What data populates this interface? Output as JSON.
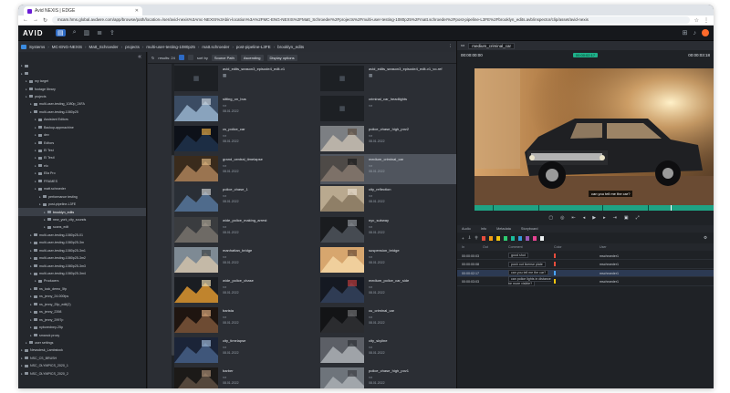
{
  "browser": {
    "tab_title": "Avid NEXIS | EDGE",
    "url": "mcam.hms.global.avdwre.com/app/browse/path/location=/ser/avid-nexis%3Amc-NEXIS%3Abin-location%3A%2FMC-ENG-NEXIS%2FMatt_Schroeder%2Fprojects%2Fmulti-user-testing-1080p25%2Fmatt.schroeder%2Fpost-pipeline-L3FE%2Fbrooklyn_edits.avb/inspector/clip/asset/avid-nexis"
  },
  "app": {
    "logo": "AVID",
    "icons": {
      "apps": "grid-icon",
      "bell": "bell-icon",
      "user": "user-icon"
    }
  },
  "breadcrumb": [
    "Systems",
    "MC-ENG-NEXIS",
    "Matt_Schroeder",
    "projects",
    "multi-user-testing-1080p25",
    "matt.schroeder",
    "post-pipeline-L3FE",
    "brooklyn_edits"
  ],
  "tree": [
    {
      "label": "",
      "depth": 0
    },
    {
      "label": "",
      "depth": 0
    },
    {
      "label": "my target",
      "depth": 1
    },
    {
      "label": "footage library",
      "depth": 1
    },
    {
      "label": "projects",
      "depth": 1
    },
    {
      "label": "multi-user-testing_1080p_24FA",
      "depth": 2
    },
    {
      "label": "multi-user-testing-1080p25",
      "depth": 2
    },
    {
      "label": "Assistant Editors",
      "depth": 3
    },
    {
      "label": "Backup-appmachine",
      "depth": 3
    },
    {
      "label": "dev",
      "depth": 3
    },
    {
      "label": "Editors",
      "depth": 3
    },
    {
      "label": "El Test",
      "depth": 3
    },
    {
      "label": "El Testl",
      "depth": 3
    },
    {
      "label": "elo",
      "depth": 3
    },
    {
      "label": "Ella Pro",
      "depth": 3
    },
    {
      "label": "FRAMES",
      "depth": 3
    },
    {
      "label": "matt.schroeder",
      "depth": 3
    },
    {
      "label": "performance testing",
      "depth": 4
    },
    {
      "label": "post-pipeline-L3FE",
      "depth": 4
    },
    {
      "label": "brooklyn_edits",
      "depth": 5,
      "selected": true
    },
    {
      "label": "new_york_city_sounds",
      "depth": 5
    },
    {
      "label": "scans_edit",
      "depth": 5
    },
    {
      "label": "multi-user-testing-1080p25-01",
      "depth": 2
    },
    {
      "label": "multi-user-testing-1080p25-3m",
      "depth": 2
    },
    {
      "label": "multi-user-testing-1080p25-3m1",
      "depth": 2
    },
    {
      "label": "multi-user-testing-1080p25-3m2",
      "depth": 2
    },
    {
      "label": "multi-user-testing-1080p25-3m3",
      "depth": 2
    },
    {
      "label": "multi-user-testing-1080p25-3m4",
      "depth": 2
    },
    {
      "label": "Producers",
      "depth": 3
    },
    {
      "label": "ns_lock_demo_5fp",
      "depth": 2
    },
    {
      "label": "ns_jenny_24.000fps",
      "depth": 2
    },
    {
      "label": "ns_jenny_25p_edit(2)",
      "depth": 2
    },
    {
      "label": "ns_jenny_2398",
      "depth": 2
    },
    {
      "label": "ns_jenny_2997p",
      "depth": 2
    },
    {
      "label": "nyboredney-25p",
      "depth": 2
    },
    {
      "label": "smanck proxy",
      "depth": 2
    },
    {
      "label": "user settings",
      "depth": 1
    },
    {
      "label": "Newsdesk_Lambstock",
      "depth": 0
    },
    {
      "label": "NSC_CS_BRUSH",
      "depth": 0
    },
    {
      "label": "NSC_OLYMPICS_2020_1",
      "depth": 0
    },
    {
      "label": "NSC_OLYMPICS_2020_2",
      "depth": 0
    }
  ],
  "toolbar": {
    "results": "results: 24",
    "sort_label": "sort by",
    "sort_value": "Source Path",
    "order": "Ascending",
    "display": "Display options"
  },
  "clips": [
    {
      "name": "avid_edits_season3_episode4_edit-v1",
      "type": "sequence",
      "date": "",
      "thumb": "empty"
    },
    {
      "name": "avid_edits_season3_episode4_edit-v1_vo-ref",
      "type": "sequence",
      "date": "",
      "thumb": "empty"
    },
    {
      "name": "sitting_on_bus",
      "type": "clip",
      "date": "08.01.2022",
      "thumb": "bus"
    },
    {
      "name": "criminal_car_headlights",
      "type": "clip",
      "date": "",
      "thumb": "empty"
    },
    {
      "name": "cs_police_car",
      "type": "clip",
      "date": "08.01.2022",
      "thumb": "night"
    },
    {
      "name": "police_chase_high_pov2",
      "type": "clip",
      "date": "08.01.2022",
      "thumb": "city"
    },
    {
      "name": "grand_central_timelapse",
      "type": "clip",
      "date": "08.01.2022",
      "thumb": "hall"
    },
    {
      "name": "medium_criminal_car",
      "type": "clip",
      "date": "08.01.2022",
      "thumb": "car",
      "selected": true
    },
    {
      "name": "police_chase_1",
      "type": "clip",
      "date": "08.01.2022",
      "thumb": "cop"
    },
    {
      "name": "city_reflection",
      "type": "clip",
      "date": "08.01.2022",
      "thumb": "glass"
    },
    {
      "name": "wide_police_making_arrest",
      "type": "clip",
      "date": "08.01.2022",
      "thumb": "street"
    },
    {
      "name": "nyc_subway",
      "type": "clip",
      "date": "08.01.2022",
      "thumb": "subway"
    },
    {
      "name": "manhattan_bridge",
      "type": "clip",
      "date": "08.01.2022",
      "thumb": "bridge"
    },
    {
      "name": "suspension_bridge",
      "type": "clip",
      "date": "08.01.2022",
      "thumb": "bridge2"
    },
    {
      "name": "wide_police_chase",
      "type": "clip",
      "date": "08.01.2022",
      "thumb": "traffic"
    },
    {
      "name": "medium_police_car_side",
      "type": "clip",
      "date": "08.01.2022",
      "thumb": "night2"
    },
    {
      "name": "barista",
      "type": "clip",
      "date": "08.01.2022",
      "thumb": "coffee"
    },
    {
      "name": "cu_criminal_car",
      "type": "clip",
      "date": "08.01.2022",
      "thumb": "dark"
    },
    {
      "name": "city_timelapse",
      "type": "clip",
      "date": "08.01.2022",
      "thumb": "sky"
    },
    {
      "name": "city_skyline",
      "type": "clip",
      "date": "08.01.2022",
      "thumb": "skyline"
    },
    {
      "name": "barber",
      "type": "clip",
      "date": "08.01.2022",
      "thumb": "barber"
    },
    {
      "name": "police_chase_high_pov1",
      "type": "clip",
      "date": "08.01.2022",
      "thumb": "city2"
    }
  ],
  "player": {
    "clip_name": "medium_criminal_car",
    "tc_in": "00:00:00:00",
    "tc_badge": "00:00:02:17",
    "tc_out": "00:00:03:18",
    "subtitle": "can you tell me the car?",
    "markers_fill": 0.85
  },
  "markers_panel": {
    "tabs": [
      "Audio",
      "Info",
      "Metadata",
      "Storyboard"
    ],
    "active_tab": "Markers",
    "headers": [
      "In",
      "Out",
      "Comment",
      "Color",
      "User"
    ],
    "rows": [
      {
        "in": "00:00:00:03",
        "out": "",
        "comment": "good shot",
        "user": "mschroeder1",
        "color": "#e74c3c"
      },
      {
        "in": "00:00:00:08",
        "out": "",
        "comment": "push out license plate",
        "user": "mschroeder1",
        "color": "#e74c3c"
      },
      {
        "in": "00:00:02:17",
        "out": "",
        "comment": "can you tell me the car?",
        "user": "mschroeder1",
        "color": "#4aa3ff",
        "selected": true
      },
      {
        "in": "00:00:03:03",
        "out": "",
        "comment": "can police lights in distance be more visible?",
        "user": "mschroeder1",
        "color": "#f1c40f"
      }
    ],
    "swatches": [
      "#e74c3c",
      "#f39c12",
      "#f1c40f",
      "#2ecc71",
      "#1abc9c",
      "#3498db",
      "#9b59b6",
      "#e84393",
      "#ecf0f1"
    ]
  }
}
